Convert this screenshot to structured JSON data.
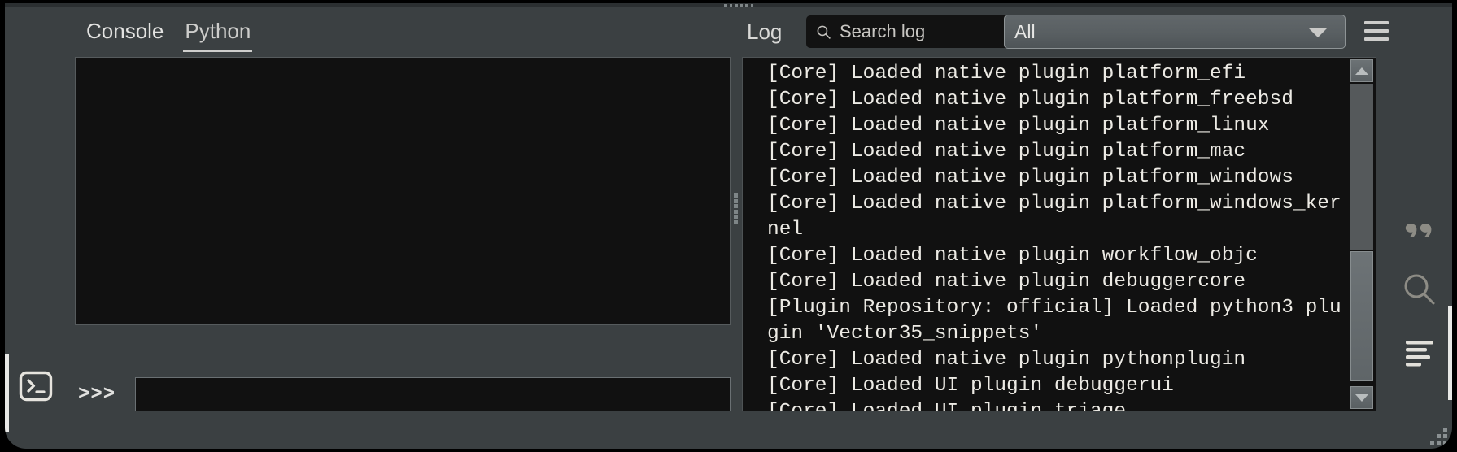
{
  "window": {
    "accent_color": "#e9e9e7",
    "panel_bg": "#3b4042",
    "console_bg": "#111111"
  },
  "header": {
    "tabs": [
      {
        "label": "Console",
        "active": false,
        "name": "tab-console"
      },
      {
        "label": "Python",
        "active": true,
        "name": "tab-python"
      }
    ],
    "log_label": "Log",
    "search": {
      "placeholder": "Search log",
      "value": "",
      "icon": "search-icon"
    },
    "filter": {
      "selected": "All",
      "options": [
        "All"
      ],
      "icon": "chevron-down-icon"
    },
    "menu_icon": "hamburger-menu-icon"
  },
  "python_console": {
    "output": "",
    "prompt_symbol": ">>>",
    "input_value": "",
    "input_placeholder": ""
  },
  "log": {
    "lines": [
      "[Core] Loaded native plugin platform_efi",
      "[Core] Loaded native plugin platform_freebsd",
      "[Core] Loaded native plugin platform_linux",
      "[Core] Loaded native plugin platform_mac",
      "[Core] Loaded native plugin platform_windows",
      "[Core] Loaded native plugin platform_windows_kernel",
      "[Core] Loaded native plugin workflow_objc",
      "[Core] Loaded native plugin debuggercore",
      "[Plugin Repository: official] Loaded python3 plugin 'Vector35_snippets'",
      "[Core] Loaded native plugin pythonplugin",
      "[Core] Loaded UI plugin debuggerui",
      "[Core] Loaded UI plugin triage"
    ],
    "scrollbar": {
      "up_arrow": "scroll-up-arrow",
      "down_arrow": "scroll-down-arrow"
    }
  },
  "left_rail": {
    "items": [
      {
        "name": "sidebar-item-console",
        "icon": "terminal-icon",
        "active": true
      }
    ]
  },
  "right_rail": {
    "items": [
      {
        "name": "sidebar-item-comments",
        "icon": "quotes-icon",
        "active": false
      },
      {
        "name": "sidebar-item-find",
        "icon": "search-icon",
        "active": false
      },
      {
        "name": "sidebar-item-log",
        "icon": "log-lines-icon",
        "active": true
      }
    ]
  },
  "splitters": {
    "horizontal_handle": "horizontal-splitter-handle",
    "vertical_handle": "vertical-splitter-handle"
  },
  "resize_grip": "window-resize-grip"
}
